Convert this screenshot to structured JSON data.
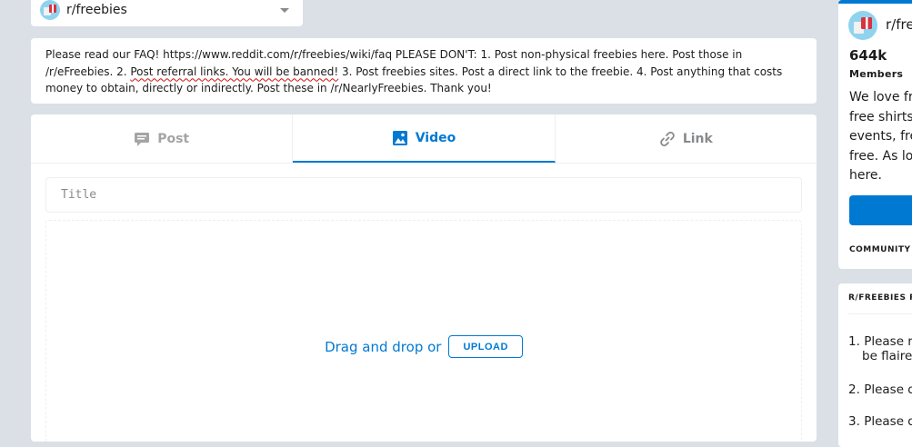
{
  "community_select": {
    "name": "r/freebies",
    "avatar_icon": "freebies-avatar-icon",
    "chevron_icon": "chevron-down-icon"
  },
  "faq": {
    "part1": "Please read our FAQ! https://www.reddit.com/r/freebies/wiki/faq PLEASE DON'T: 1. Post non-physical freebies here. Post those in /r/eFreebies. 2. ",
    "underlined": "Post referral links. You will be banned!",
    "part2": " 3. Post freebies sites. Post a direct link to the freebie. 4. Post anything that costs money to obtain, directly or indirectly. Post these in /r/NearlyFreebies. Thank you!"
  },
  "post_form": {
    "tabs": [
      {
        "label": "Post",
        "icon": "post-icon",
        "active": false
      },
      {
        "label": "Video",
        "icon": "image-icon",
        "active": true
      },
      {
        "label": "Link",
        "icon": "link-icon",
        "active": false
      }
    ],
    "title_placeholder": "Title",
    "drop_text": "Drag and drop or",
    "upload_label": "UPLOAD"
  },
  "sidebar": {
    "name": "r/fre",
    "members_count": "644k",
    "members_label": "Members",
    "description_lines": [
      "We love fre",
      "free shirts,",
      "events, fre",
      "free. As lor",
      "here."
    ],
    "community_options": "COMMUNITY",
    "rules_title": "R/FREEBIES R",
    "rules": [
      {
        "num": "1.",
        "text": "Please re",
        "cont": "be flaired"
      },
      {
        "num": "2.",
        "text": "Please d"
      },
      {
        "num": "3.",
        "text": "Please d"
      }
    ]
  },
  "colors": {
    "accent": "#0079d3",
    "background": "#dae0e6",
    "underline": "#d01010"
  }
}
